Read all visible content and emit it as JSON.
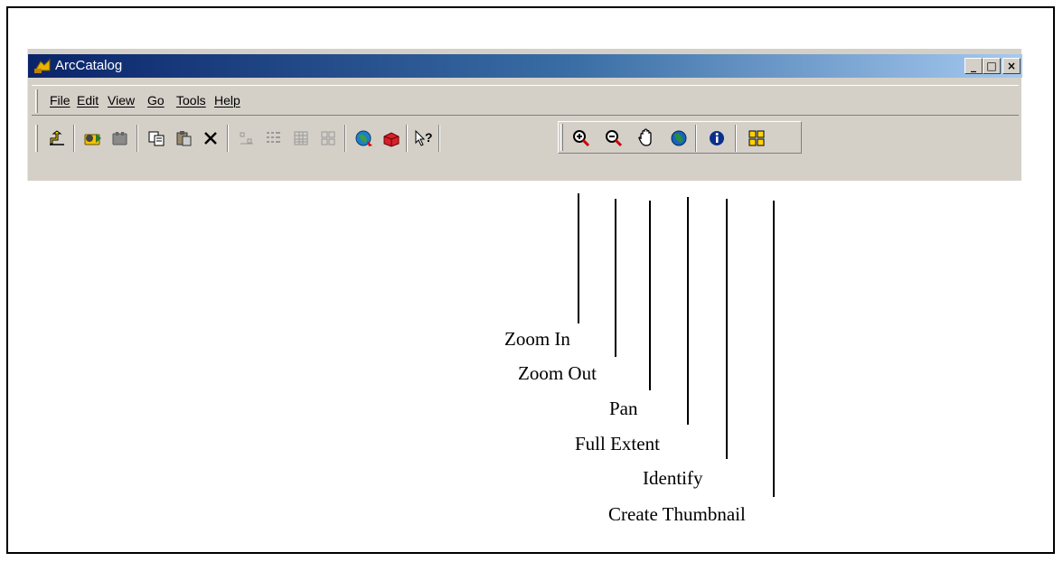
{
  "window": {
    "title": "ArcCatalog",
    "minimize_label": "_",
    "maximize_label": "□",
    "close_label": "×"
  },
  "menu": {
    "items": [
      "File",
      "Edit",
      "View",
      "Go",
      "Tools",
      "Help"
    ]
  },
  "toolbar": {
    "buttons": [
      "up-one-level-icon",
      "connect-folder-icon",
      "disconnect-folder-icon",
      "copy-icon",
      "paste-icon",
      "delete-icon",
      "large-icons-icon",
      "list-icon",
      "details-icon",
      "thumbnails-icon",
      "launch-arcmap-icon",
      "arctoolbox-icon",
      "whats-this-icon",
      "zoom-in-icon",
      "zoom-out-icon",
      "pan-icon",
      "full-extent-icon",
      "identify-icon",
      "create-thumbnail-icon"
    ]
  },
  "callouts": [
    {
      "label": "Zoom In"
    },
    {
      "label": "Zoom Out"
    },
    {
      "label": "Pan"
    },
    {
      "label": "Full Extent"
    },
    {
      "label": "Identify"
    },
    {
      "label": "Create Thumbnail"
    }
  ]
}
